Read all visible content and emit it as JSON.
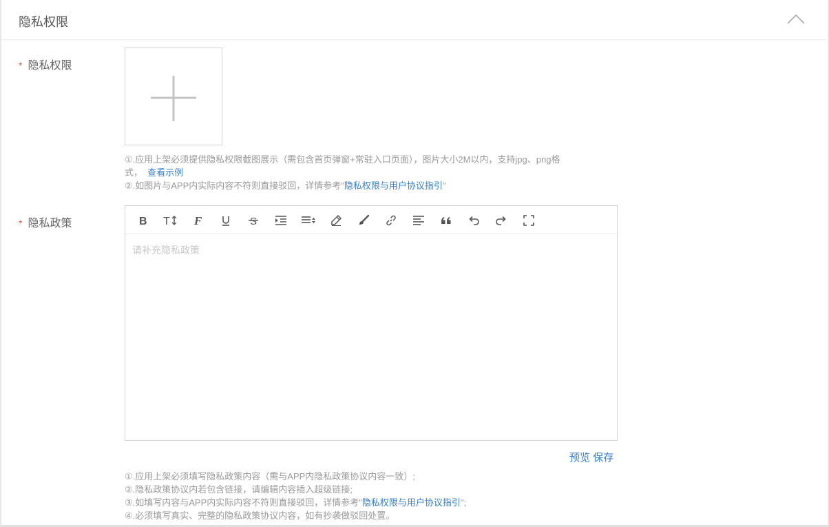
{
  "section": {
    "title": "隐私权限",
    "collapse_icon": "chevron-up-icon"
  },
  "privacy_permission": {
    "required_mark": "*",
    "label": "隐私权限",
    "upload_icon": "plus-icon",
    "help_line1_a": "①.应用上架必须提供隐私权限截图展示（需包含首页弹窗+常驻入口页面），图片大小2M以内，支持jpg、png格",
    "help_line1_b": "式，",
    "example_link": "查看示例",
    "help_line2_a": "②.如图片与APP内实际内容不符则直接驳回，详情参考\"",
    "help_line2_link": "隐私权限与用户协议指引",
    "help_line2_b": "\""
  },
  "privacy_policy": {
    "required_mark": "*",
    "label": "隐私政策",
    "placeholder": "请补充隐私政策",
    "toolbar": [
      "bold-icon",
      "text-size-icon",
      "font-family-icon",
      "underline-icon",
      "strikethrough-icon",
      "indent-icon",
      "line-height-icon",
      "eraser-icon",
      "brush-icon",
      "link-icon",
      "align-left-icon",
      "quote-icon",
      "undo-icon",
      "redo-icon",
      "fullscreen-icon"
    ],
    "preview_label": "预览",
    "save_label": "保存",
    "help1": "①.应用上架必须填写隐私政策内容（需与APP内隐私政策协议内容一致）;",
    "help2": "②.隐私政策协议内若包含链接，请编辑内容插入超级链接;",
    "help3_a": "③.如填写内容与APP内实际内容不符则直接驳回，详情参考\"",
    "help3_link": "隐私权限与用户协议指引",
    "help3_b": "\";",
    "help4": "④.必须填写真实、完整的隐私政策协议内容，如有抄袭做驳回处置。"
  },
  "colors": {
    "link": "#3a7fc6",
    "required": "#e5573f",
    "icon": "#555555"
  }
}
